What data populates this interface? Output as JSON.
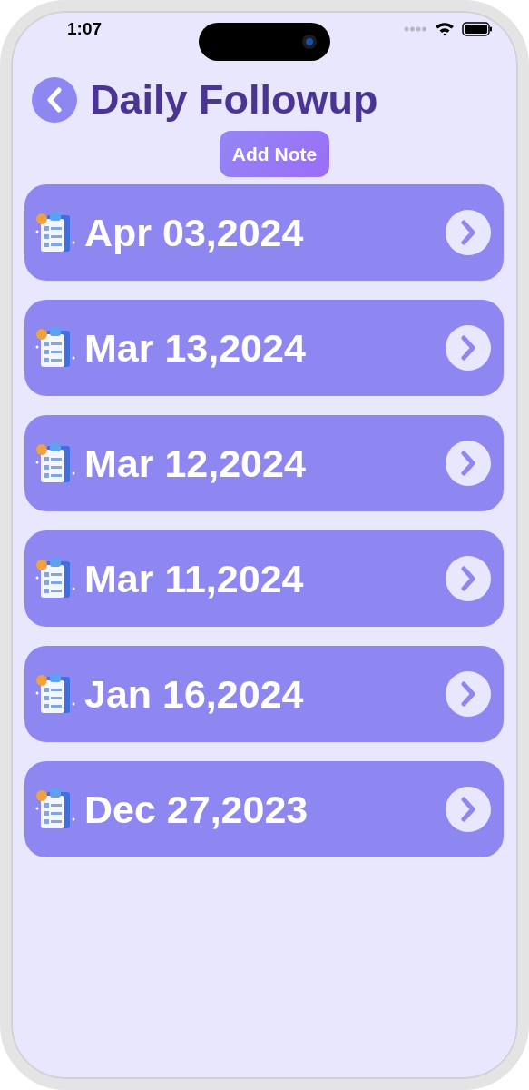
{
  "status_bar": {
    "time": "1:07"
  },
  "header": {
    "title": "Daily Followup"
  },
  "add_button": {
    "label": "Add Note"
  },
  "entries": [
    {
      "date": "Apr 03,2024"
    },
    {
      "date": "Mar 13,2024"
    },
    {
      "date": "Mar 12,2024"
    },
    {
      "date": "Mar 11,2024"
    },
    {
      "date": "Jan 16,2024"
    },
    {
      "date": "Dec 27,2023"
    }
  ]
}
